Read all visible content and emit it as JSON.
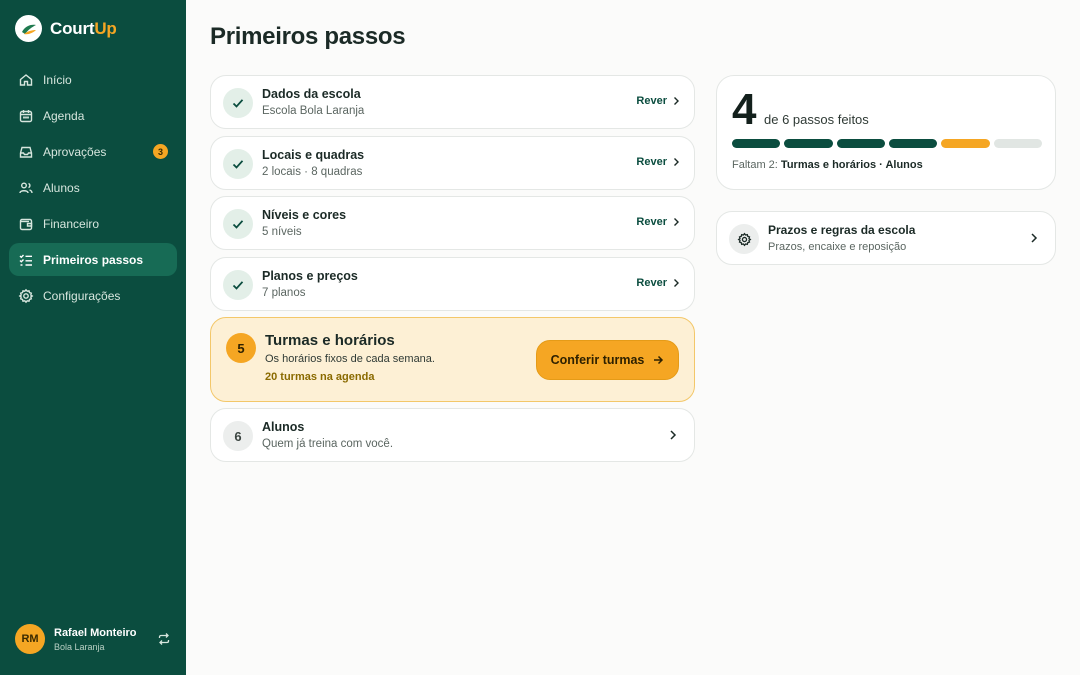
{
  "brand": {
    "name_main": "Court",
    "name_accent": "Up"
  },
  "sidebar": {
    "items": [
      {
        "label": "Início",
        "icon": "home-icon"
      },
      {
        "label": "Agenda",
        "icon": "calendar-icon"
      },
      {
        "label": "Aprovações",
        "icon": "inbox-icon",
        "badge": "3"
      },
      {
        "label": "Alunos",
        "icon": "users-icon"
      },
      {
        "label": "Financeiro",
        "icon": "wallet-icon"
      },
      {
        "label": "Primeiros passos",
        "icon": "checklist-icon",
        "active": true
      },
      {
        "label": "Configurações",
        "icon": "gear-icon"
      }
    ]
  },
  "user": {
    "initials": "RM",
    "name": "Rafael Monteiro",
    "school": "Bola Laranja"
  },
  "page": {
    "title": "Primeiros passos"
  },
  "steps": [
    {
      "title": "Dados da escola",
      "subtitle": "Escola Bola Laranja",
      "action": "Rever"
    },
    {
      "title": "Locais e quadras",
      "subtitle": "2 locais · 8 quadras",
      "action": "Rever"
    },
    {
      "title": "Níveis e cores",
      "subtitle": "5 níveis",
      "action": "Rever"
    },
    {
      "title": "Planos e preços",
      "subtitle": "7 planos",
      "action": "Rever"
    }
  ],
  "current_step": {
    "number": "5",
    "title": "Turmas e horários",
    "subtitle": "Os horários fixos de cada semana.",
    "meta": "20 turmas na agenda",
    "cta": "Conferir turmas"
  },
  "next_step": {
    "number": "6",
    "title": "Alunos",
    "subtitle": "Quem já treina com você."
  },
  "progress": {
    "done": "4",
    "label": "de 6 passos feitos",
    "remaining_prefix": "Faltam 2:",
    "remaining_items": "Turmas e horários · Alunos",
    "segments": [
      "done",
      "done",
      "done",
      "done",
      "current",
      "todo"
    ]
  },
  "rules": {
    "title": "Prazos e regras da escola",
    "subtitle": "Prazos, encaixe e reposição"
  },
  "colors": {
    "sidebar": "#0b4d3f",
    "accent": "#f5a623",
    "active_item": "#176b55"
  }
}
